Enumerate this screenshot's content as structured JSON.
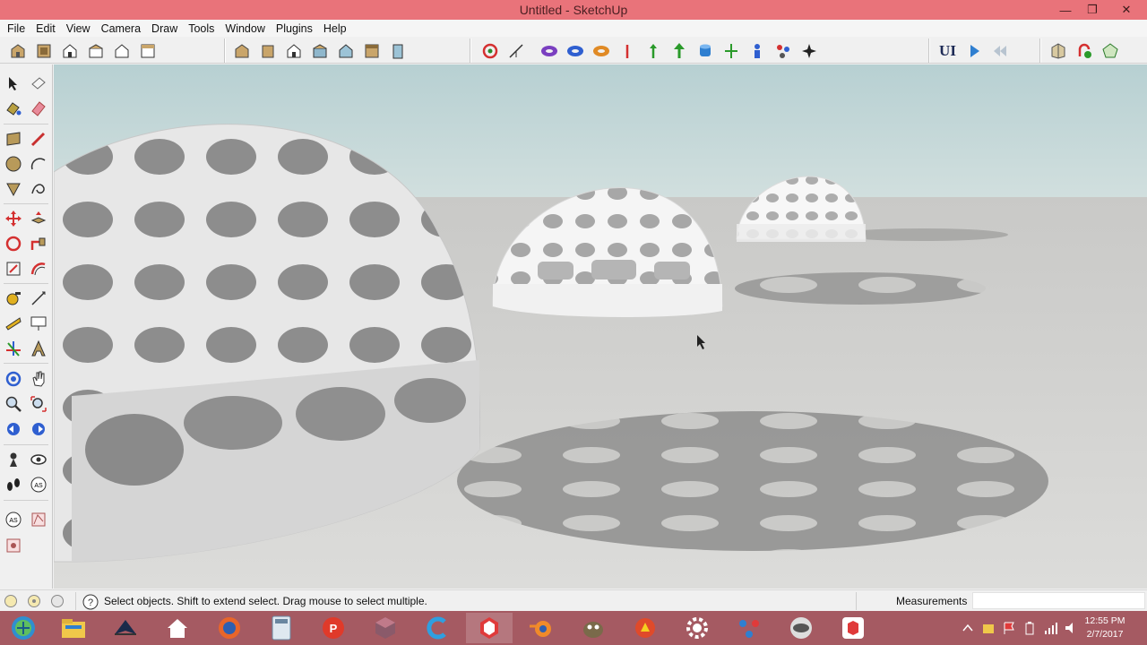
{
  "window": {
    "title": "Untitled - SketchUp",
    "minimize": "—",
    "maximize": "❐",
    "close": "✕"
  },
  "menu": [
    "File",
    "Edit",
    "View",
    "Camera",
    "Draw",
    "Tools",
    "Window",
    "Plugins",
    "Help"
  ],
  "toolbar": {
    "views": [
      "iso-view-icon",
      "top-view-icon",
      "front-view-icon",
      "right-view-icon",
      "back-view-icon",
      "left-view-icon"
    ],
    "styles": [
      "xray-icon",
      "back-edges-icon",
      "wireframe-icon",
      "hidden-line-icon",
      "shaded-icon",
      "shaded-textures-icon",
      "monochrome-icon"
    ],
    "sandbox": [
      "orbit-sync-icon",
      "smoove-icon",
      "torus-purple-icon",
      "torus-blue-icon",
      "torus-orange-icon",
      "axis-red-icon",
      "axis-green-icon",
      "arrow-up-icon",
      "cylinder-blue-icon",
      "move-green-icon",
      "figure-blue-icon",
      "star-molecule-icon",
      "star-dark-icon"
    ],
    "ui_label": "UI",
    "player": [
      "play-icon",
      "rewind-icon"
    ],
    "right": [
      "warehouse-icon",
      "extension-icon",
      "share-model-icon"
    ]
  },
  "statusbar": {
    "hint": "Select objects. Shift to extend select. Drag mouse to select multiple.",
    "measurements_label": "Measurements",
    "measurements_value": ""
  },
  "taskbar": {
    "apps": [
      "windows-start-icon",
      "file-explorer-icon",
      "sketchup-pro-icon",
      "home-icon",
      "firefox-icon",
      "calculator-icon",
      "wps-presentation-icon",
      "3d-cube-icon",
      "ccleaner-icon",
      "sketchup-icon",
      "blender-icon",
      "gimp-icon",
      "wine-icon",
      "settings-gear-icon",
      "network-icon",
      "eye-app-icon",
      "layout-box-icon"
    ],
    "time": "12:55 PM",
    "date": "2/7/2017"
  },
  "colors": {
    "accent": "#e9737a",
    "taskbar": "#a55a62",
    "sky": "#c2d7d8",
    "ground": "#d4d4d2"
  }
}
